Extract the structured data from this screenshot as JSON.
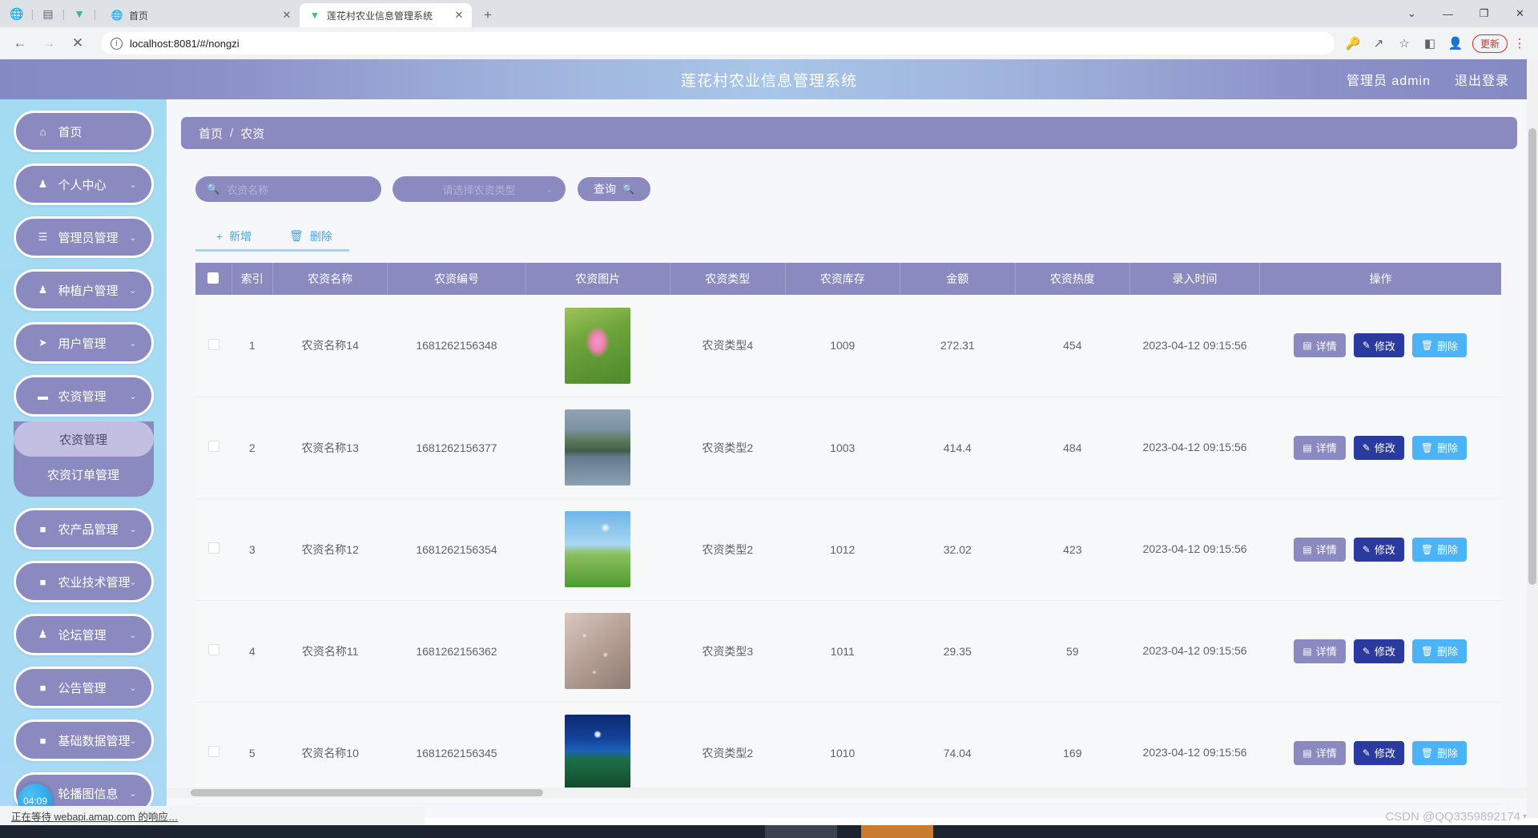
{
  "browser": {
    "sys_icons": [
      "globe-icon",
      "window-icon",
      "v-logo-icon"
    ],
    "tabs": [
      {
        "favicon": "globe-icon",
        "title": "首页",
        "active": false
      },
      {
        "favicon": "v-logo-icon",
        "title": "莲花村农业信息管理系统",
        "active": true
      }
    ],
    "new_tab_label": "+",
    "window_controls": [
      "chevron-down-icon",
      "minimize-icon",
      "maximize-icon",
      "close-icon"
    ],
    "nav": {
      "back": "←",
      "forward": "→",
      "stop": "✕"
    },
    "url": "localhost:8081/#/nongzi",
    "toolbar_icons": [
      "key-icon",
      "share-icon",
      "star-icon",
      "sidepanel-icon",
      "profile-icon"
    ],
    "update_label": "更新",
    "kebab": "⋮"
  },
  "app": {
    "title": "莲花村农业信息管理系统",
    "user_label": "管理员 admin",
    "logout_label": "退出登录"
  },
  "sidebar": {
    "items": [
      {
        "label": "首页",
        "icon": "home-icon",
        "glyph": "⌂",
        "expandable": false
      },
      {
        "label": "个人中心",
        "icon": "user-icon",
        "glyph": "♟",
        "expandable": true
      },
      {
        "label": "管理员管理",
        "icon": "list-icon",
        "glyph": "☰",
        "expandable": true
      },
      {
        "label": "种植户管理",
        "icon": "person-icon",
        "glyph": "♟",
        "expandable": true
      },
      {
        "label": "用户管理",
        "icon": "send-icon",
        "glyph": "➤",
        "expandable": true
      },
      {
        "label": "农资管理",
        "icon": "briefcase-icon",
        "glyph": "▬",
        "expandable": true
      },
      {
        "label": "农产品管理",
        "icon": "grid-icon",
        "glyph": "■",
        "expandable": true
      },
      {
        "label": "农业技术管理",
        "icon": "grid-icon",
        "glyph": "■",
        "expandable": true
      },
      {
        "label": "论坛管理",
        "icon": "person-icon",
        "glyph": "♟",
        "expandable": true
      },
      {
        "label": "公告管理",
        "icon": "grid-icon",
        "glyph": "■",
        "expandable": true
      },
      {
        "label": "基础数据管理",
        "icon": "grid-icon",
        "glyph": "■",
        "expandable": true
      },
      {
        "label": "轮播图信息",
        "icon": "grid-icon",
        "glyph": "■",
        "expandable": true
      }
    ],
    "submenu_parent_index": 5,
    "submenu": [
      {
        "label": "农资管理",
        "active": true
      },
      {
        "label": "农资订单管理",
        "active": false
      }
    ]
  },
  "breadcrumb": {
    "home": "首页",
    "separator": "/",
    "current": "农资"
  },
  "filters": {
    "name_placeholder": "农资名称",
    "name_value": "",
    "type_placeholder": "请选择农资类型",
    "search_label": "查询"
  },
  "toolbar": {
    "add_label": "新增",
    "delete_label": "删除"
  },
  "table": {
    "columns": [
      "索引",
      "农资名称",
      "农资编号",
      "农资图片",
      "农资类型",
      "农资库存",
      "金额",
      "农资热度",
      "录入时间",
      "操作"
    ],
    "row_actions": {
      "detail": "详情",
      "edit": "修改",
      "delete": "删除"
    },
    "rows": [
      {
        "index": "1",
        "name": "农资名称14",
        "code": "1681262156348",
        "image": "lotus-flower-photo",
        "type": "农资类型4",
        "stock": "1009",
        "amount": "272.31",
        "heat": "454",
        "time": "2023-04-12 09:15:56"
      },
      {
        "index": "2",
        "name": "农资名称13",
        "code": "1681262156377",
        "image": "mountain-lake-village-photo",
        "type": "农资类型2",
        "stock": "1003",
        "amount": "414.4",
        "heat": "484",
        "time": "2023-04-12 09:15:56"
      },
      {
        "index": "3",
        "name": "农资名称12",
        "code": "1681262156354",
        "image": "green-meadow-sky-photo",
        "type": "农资类型2",
        "stock": "1012",
        "amount": "32.02",
        "heat": "423",
        "time": "2023-04-12 09:15:56"
      },
      {
        "index": "4",
        "name": "农资名称11",
        "code": "1681262156362",
        "image": "cherry-blossom-photo",
        "type": "农资类型3",
        "stock": "1011",
        "amount": "29.35",
        "heat": "59",
        "time": "2023-04-12 09:15:56"
      },
      {
        "index": "5",
        "name": "农资名称10",
        "code": "1681262156345",
        "image": "night-moon-field-photo",
        "type": "农资类型2",
        "stock": "1010",
        "amount": "74.04",
        "heat": "169",
        "time": "2023-04-12 09:15:56"
      }
    ]
  },
  "status": {
    "bubble_time": "04:09",
    "loading_text": "正在等待 webapi.amap.com 的响应…"
  },
  "watermark": "CSDN @QQ3359892174",
  "colors": {
    "primary_purple": "#8b8ac0",
    "sidebar_blue": "#a3dcf2",
    "edit_blue": "#2b3a9e",
    "delete_blue": "#4cb3f7",
    "link_blue": "#4fa3d8"
  }
}
